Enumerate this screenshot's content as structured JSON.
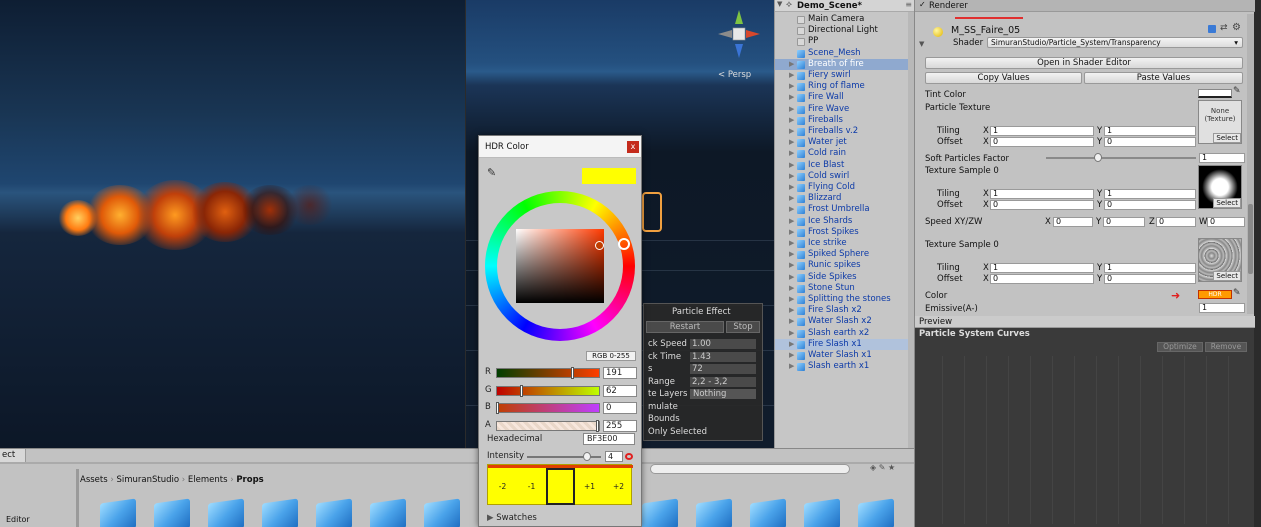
{
  "game_view": {},
  "scene_view": {
    "persp_label": "< Persp"
  },
  "hierarchy": {
    "scene_name": "Demo_Scene*",
    "items": [
      {
        "label": "Main Camera",
        "style": "plain"
      },
      {
        "label": "Directional Light",
        "style": "plain"
      },
      {
        "label": "PP",
        "style": "plain"
      },
      {
        "label": "Scene_Mesh",
        "style": "blue"
      },
      {
        "label": "Breath of fire",
        "style": "sel"
      },
      {
        "label": "Fiery swirl",
        "style": "blue"
      },
      {
        "label": "Ring of flame",
        "style": "blue"
      },
      {
        "label": "Fire Wall",
        "style": "blue"
      },
      {
        "label": "Fire Wave",
        "style": "blue"
      },
      {
        "label": "Fireballs",
        "style": "blue"
      },
      {
        "label": "Fireballs v.2",
        "style": "blue"
      },
      {
        "label": "Water jet",
        "style": "blue"
      },
      {
        "label": "Cold rain",
        "style": "blue"
      },
      {
        "label": "Ice Blast",
        "style": "blue"
      },
      {
        "label": "Cold swirl",
        "style": "blue"
      },
      {
        "label": "Flying Cold",
        "style": "blue"
      },
      {
        "label": "Blizzard",
        "style": "blue"
      },
      {
        "label": "Frost Umbrella",
        "style": "blue"
      },
      {
        "label": "Ice Shards",
        "style": "blue"
      },
      {
        "label": "Frost Spikes",
        "style": "blue"
      },
      {
        "label": "Ice strike",
        "style": "blue"
      },
      {
        "label": "Spiked Sphere",
        "style": "blue"
      },
      {
        "label": "Runic spikes",
        "style": "blue"
      },
      {
        "label": "Side Spikes",
        "style": "blue"
      },
      {
        "label": "Stone Stun",
        "style": "blue"
      },
      {
        "label": "Splitting the stones",
        "style": "blue"
      },
      {
        "label": "Fire Slash x2",
        "style": "blue"
      },
      {
        "label": "Water Slash x2",
        "style": "blue"
      },
      {
        "label": "Slash earth x2",
        "style": "blue"
      },
      {
        "label": "Fire Slash x1",
        "style": "hl"
      },
      {
        "label": "Water Slash x1",
        "style": "blue"
      },
      {
        "label": "Slash earth x1",
        "style": "blue"
      }
    ]
  },
  "inspector": {
    "renderer_label": "Renderer",
    "material_name": "M_SS_Faire_05",
    "shader_label": "Shader",
    "shader_value": "SimuranStudio/Particle_System/Transparency",
    "open_shader_editor": "Open in Shader Editor",
    "copy_values": "Copy Values",
    "paste_values": "Paste Values",
    "tint_color": "Tint Color",
    "particle_texture": "Particle Texture",
    "none_texture": "None\n(Texture)",
    "select": "Select",
    "tiling": "Tiling",
    "offset": "Offset",
    "x": "X",
    "y": "Y",
    "z": "Z",
    "w": "W",
    "one": "1",
    "zero": "0",
    "soft_particles": "Soft Particles Factor",
    "soft_value": "1",
    "texture_sample_0": "Texture Sample 0",
    "speed_xyzw": "Speed XY/ZW",
    "color_label": "Color",
    "hdr_tag": "HDR",
    "emissive_label": "Emissive(A-)",
    "emissive_value": "1"
  },
  "preview": {
    "tab": "Preview",
    "curves_title": "Particle System Curves",
    "optimize": "Optimize",
    "remove": "Remove"
  },
  "project": {
    "tab": "ect",
    "breadcrumb": [
      "Assets",
      "SimuranStudio",
      "Elements",
      "Props"
    ],
    "left_item": "Editor",
    "asset_count": 15
  },
  "particle_effect": {
    "title": "Particle Effect",
    "restart": "Restart",
    "stop": "Stop",
    "rows": [
      {
        "label": "ck Speed",
        "value": "1.00"
      },
      {
        "label": "ck Time",
        "value": "1.43"
      },
      {
        "label": "s",
        "value": "72"
      },
      {
        "label": "Range",
        "value": "2,2 - 3,2"
      },
      {
        "label": "te Layers",
        "value": "Nothing"
      },
      {
        "label": "mulate",
        "value": ""
      },
      {
        "label": "Bounds",
        "value": ""
      },
      {
        "label": "Only Selected",
        "value": ""
      }
    ]
  },
  "hdr_color": {
    "title": "HDR Color",
    "mode_button": "RGB 0-255",
    "channels": [
      {
        "ch": "R",
        "value": "191",
        "pos": 0.75
      },
      {
        "ch": "G",
        "value": "62",
        "pos": 0.24
      },
      {
        "ch": "B",
        "value": "0",
        "pos": 0.0
      },
      {
        "ch": "A",
        "value": "255",
        "pos": 1.0
      }
    ],
    "hex_label": "Hexadecimal",
    "hex_value": "BF3E00",
    "intensity_label": "Intensity",
    "intensity_value": "4",
    "intensity_pos": 0.78,
    "swatch_labels": [
      "-2",
      "-1",
      "",
      "+1",
      "+2"
    ],
    "swatches_label": "Swatches",
    "colors": {
      "preview": "#ffff00",
      "picked": "#bf3e00"
    }
  }
}
